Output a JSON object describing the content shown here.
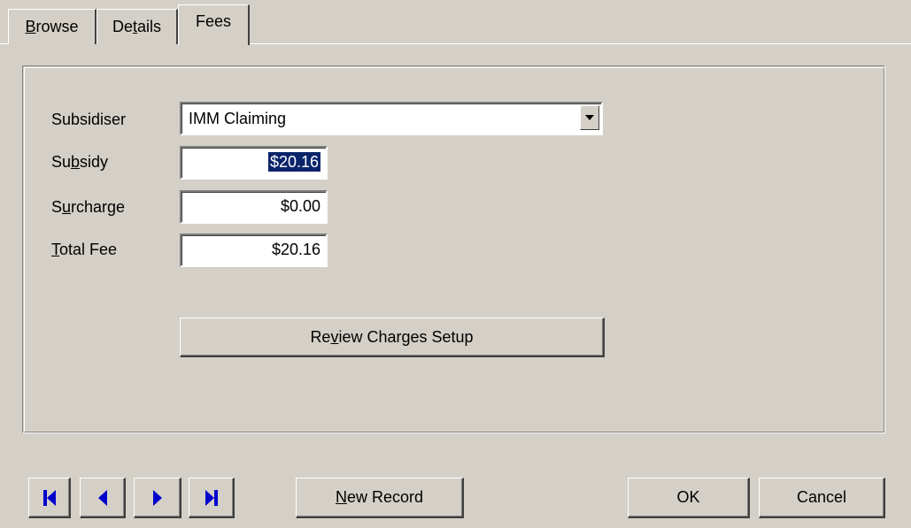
{
  "tabs": [
    {
      "label_pre": "",
      "label_u": "B",
      "label_post": "rowse"
    },
    {
      "label_pre": "De",
      "label_u": "t",
      "label_post": "ails"
    },
    {
      "label_pre": "Fees",
      "label_u": "",
      "label_post": ""
    }
  ],
  "form": {
    "subsidiser": {
      "label": "Subsidiser",
      "value": "IMM Claiming"
    },
    "subsidy": {
      "label_pre": "Su",
      "label_u": "b",
      "label_post": "sidy",
      "value": "$20.16"
    },
    "surcharge": {
      "label_pre": "S",
      "label_u": "u",
      "label_post": "rcharge",
      "value": "$0.00"
    },
    "total_fee": {
      "label_pre": "",
      "label_u": "T",
      "label_post": "otal Fee",
      "value": "$20.16"
    },
    "review_button": {
      "label_pre": "Re",
      "label_u": "v",
      "label_post": "iew Charges Setup"
    }
  },
  "footer": {
    "new_record": {
      "label_pre": "",
      "label_u": "N",
      "label_post": "ew Record"
    },
    "ok": "OK",
    "cancel": "Cancel",
    "nav_icons": [
      "first-record-icon",
      "previous-record-icon",
      "next-record-icon",
      "last-record-icon"
    ]
  },
  "colors": {
    "background": "#d4d0c8",
    "selection": "#0a246a",
    "nav_icon": "#0000cc"
  }
}
